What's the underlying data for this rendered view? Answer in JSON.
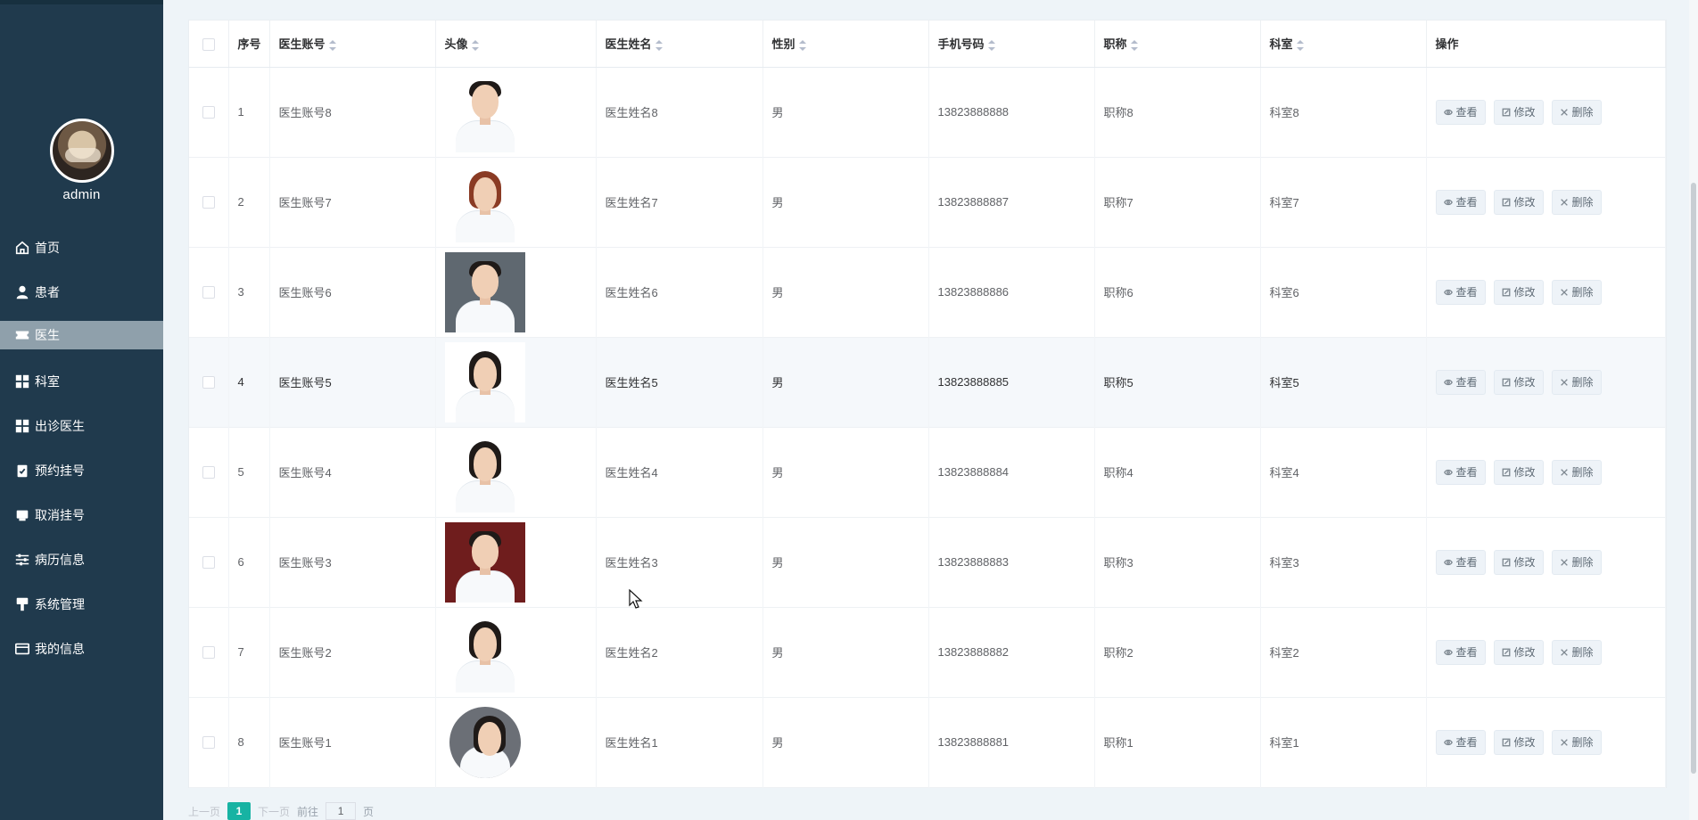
{
  "user": {
    "name": "admin"
  },
  "menu": [
    {
      "label": "首页",
      "icon": "home-icon",
      "active": false
    },
    {
      "label": "患者",
      "icon": "user-icon",
      "active": false
    },
    {
      "label": "医生",
      "icon": "ticket-icon",
      "active": true
    },
    {
      "label": "科室",
      "icon": "grid-icon",
      "active": false
    },
    {
      "label": "出诊医生",
      "icon": "grid-icon",
      "active": false
    },
    {
      "label": "预约挂号",
      "icon": "clipboard-icon",
      "active": false
    },
    {
      "label": "取消挂号",
      "icon": "printer-icon",
      "active": false
    },
    {
      "label": "病历信息",
      "icon": "sliders-icon",
      "active": false
    },
    {
      "label": "系统管理",
      "icon": "brush-icon",
      "active": false
    },
    {
      "label": "我的信息",
      "icon": "card-icon",
      "active": false
    }
  ],
  "table": {
    "headers": {
      "no": "序号",
      "account": "医生账号",
      "avatar": "头像",
      "name": "医生姓名",
      "gender": "性别",
      "phone": "手机号码",
      "title": "职称",
      "dept": "科室",
      "actions": "操作"
    },
    "action_labels": {
      "view": "查看",
      "edit": "修改",
      "delete": "删除"
    },
    "rows": [
      {
        "no": "1",
        "account": "医生账号8",
        "name": "医生姓名8",
        "gender": "男",
        "phone": "13823888888",
        "title": "职称8",
        "dept": "科室8",
        "photo": "male-suit"
      },
      {
        "no": "2",
        "account": "医生账号7",
        "name": "医生姓名7",
        "gender": "男",
        "phone": "13823888887",
        "title": "职称7",
        "dept": "科室7",
        "photo": "female-red-hair"
      },
      {
        "no": "3",
        "account": "医生账号6",
        "name": "医生姓名6",
        "gender": "男",
        "phone": "13823888886",
        "title": "职称6",
        "dept": "科室6",
        "photo": "male-grey-bg"
      },
      {
        "no": "4",
        "account": "医生账号5",
        "name": "医生姓名5",
        "gender": "男",
        "phone": "13823888885",
        "title": "职称5",
        "dept": "科室5",
        "photo": "female-dark-hair",
        "hover": true
      },
      {
        "no": "5",
        "account": "医生账号4",
        "name": "医生姓名4",
        "gender": "男",
        "phone": "13823888884",
        "title": "职称4",
        "dept": "科室4",
        "photo": "female-glasses"
      },
      {
        "no": "6",
        "account": "医生账号3",
        "name": "医生姓名3",
        "gender": "男",
        "phone": "13823888883",
        "title": "职称3",
        "dept": "科室3",
        "photo": "male-red-bg"
      },
      {
        "no": "7",
        "account": "医生账号2",
        "name": "医生姓名2",
        "gender": "男",
        "phone": "13823888882",
        "title": "职称2",
        "dept": "科室2",
        "photo": "female-dark-hair"
      },
      {
        "no": "8",
        "account": "医生账号1",
        "name": "医生姓名1",
        "gender": "男",
        "phone": "13823888881",
        "title": "职称1",
        "dept": "科室1",
        "photo": "female-round"
      }
    ]
  },
  "pagination": {
    "prev": "上一页",
    "current": "1",
    "next": "下一页",
    "goto_prefix": "前往",
    "goto_value": "1",
    "goto_suffix": "页"
  }
}
